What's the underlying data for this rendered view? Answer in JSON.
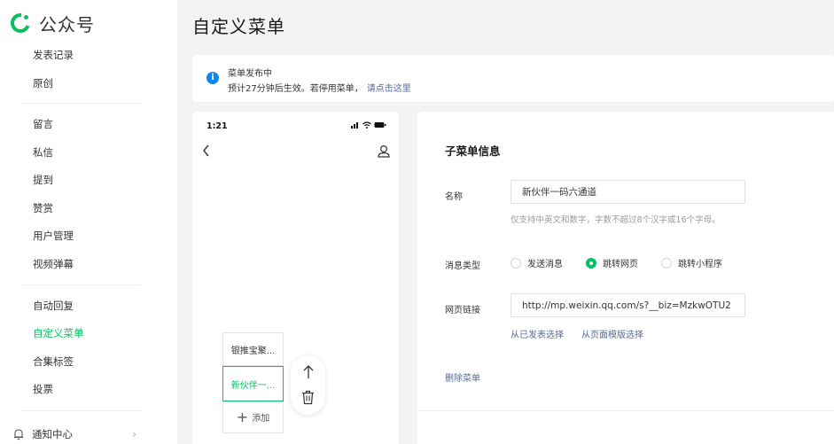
{
  "brand": {
    "name": "公众号",
    "accent": "#07c160"
  },
  "sidebar": {
    "items": [
      {
        "label": "发表记录",
        "active": false
      },
      {
        "label": "原创",
        "active": false
      },
      {
        "label": "留言",
        "active": false
      },
      {
        "label": "私信",
        "active": false
      },
      {
        "label": "提到",
        "active": false
      },
      {
        "label": "赞赏",
        "active": false
      },
      {
        "label": "用户管理",
        "active": false
      },
      {
        "label": "视频弹幕",
        "active": false
      },
      {
        "label": "自动回复",
        "active": false
      },
      {
        "label": "自定义菜单",
        "active": true
      },
      {
        "label": "合集标签",
        "active": false
      },
      {
        "label": "投票",
        "active": false
      }
    ],
    "notify_label": "通知中心",
    "icons": {
      "notify": "bell-icon",
      "arrow": "chevron-right-icon"
    }
  },
  "header": {
    "title": "自定义菜单"
  },
  "notice": {
    "title": "菜单发布中",
    "desc": "预计27分钟后生效。若停用菜单，",
    "link": "请点击这里",
    "icon": "info-icon"
  },
  "phone": {
    "time": "1:21",
    "submenus": [
      {
        "label": "银推宝聚...",
        "selected": false
      },
      {
        "label": "新伙伴一...",
        "selected": true
      }
    ],
    "add_label": "添加",
    "icons": [
      "signal-icon",
      "wifi-icon",
      "battery-icon",
      "back-icon",
      "profile-icon",
      "arrow-up-icon",
      "trash-icon"
    ]
  },
  "form": {
    "title": "子菜单信息",
    "name_label": "名称",
    "name_value": "新伙伴一码六通道",
    "name_hint": "仅支持中英文和数字，字数不超过8个汉字或16个字母。",
    "type_label": "消息类型",
    "type_options": [
      {
        "label": "发送消息",
        "checked": false
      },
      {
        "label": "跳转网页",
        "checked": true
      },
      {
        "label": "跳转小程序",
        "checked": false
      }
    ],
    "url_label": "网页链接",
    "url_value": "http://mp.weixin.qq.com/s?__biz=MzkwOTU2",
    "url_link_published": "从已发表选择",
    "url_link_template": "从页面模版选择",
    "delete_label": "删除菜单"
  }
}
